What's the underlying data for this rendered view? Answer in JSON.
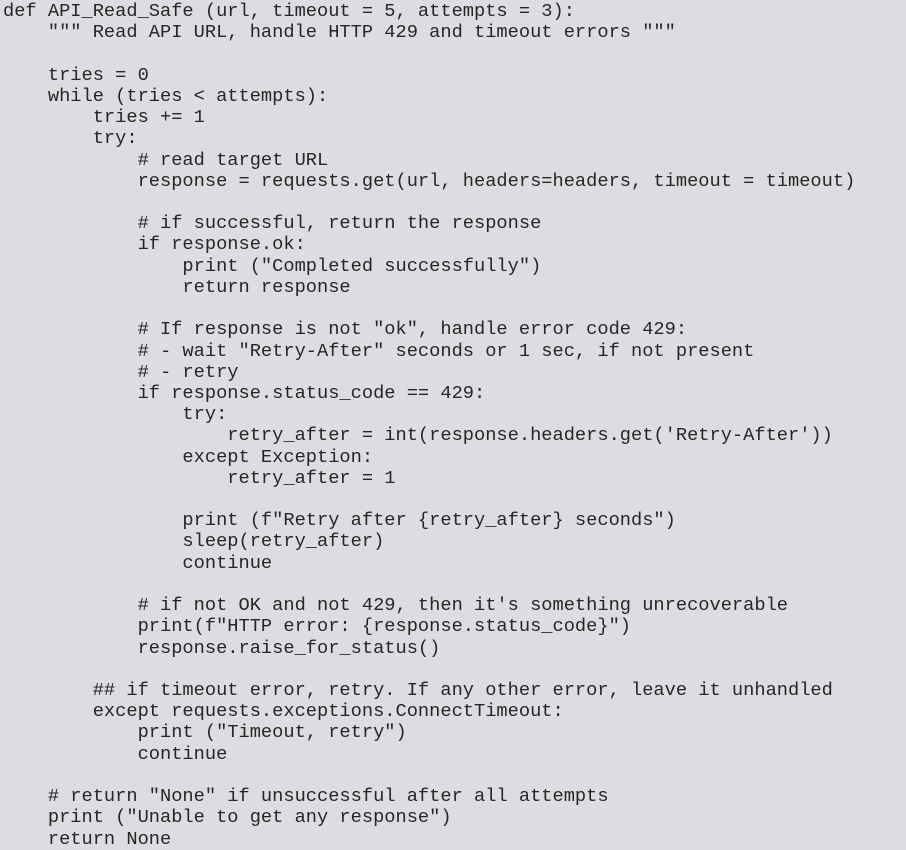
{
  "editor": {
    "language": "python",
    "colors": {
      "background": "#dcdde0",
      "text": "#262626"
    },
    "lines": [
      "def API_Read_Safe (url, timeout = 5, attempts = 3):",
      "    \"\"\" Read API URL, handle HTTP 429 and timeout errors \"\"\"",
      "",
      "    tries = 0",
      "    while (tries < attempts):",
      "        tries += 1",
      "        try:",
      "            # read target URL",
      "            response = requests.get(url, headers=headers, timeout = timeout)",
      "",
      "            # if successful, return the response",
      "            if response.ok:",
      "                print (\"Completed successfully\")",
      "                return response",
      "",
      "            # If response is not \"ok\", handle error code 429:",
      "            # - wait \"Retry-After\" seconds or 1 sec, if not present",
      "            # - retry",
      "            if response.status_code == 429:",
      "                try:",
      "                    retry_after = int(response.headers.get('Retry-After'))",
      "                except Exception:",
      "                    retry_after = 1",
      "",
      "                print (f\"Retry after {retry_after} seconds\")",
      "                sleep(retry_after)",
      "                continue",
      "",
      "            # if not OK and not 429, then it's something unrecoverable",
      "            print(f\"HTTP error: {response.status_code}\")",
      "            response.raise_for_status()",
      "",
      "        ## if timeout error, retry. If any other error, leave it unhandled",
      "        except requests.exceptions.ConnectTimeout:",
      "            print (\"Timeout, retry\")",
      "            continue",
      "",
      "    # return \"None\" if unsuccessful after all attempts",
      "    print (\"Unable to get any response\")",
      "    return None"
    ]
  }
}
